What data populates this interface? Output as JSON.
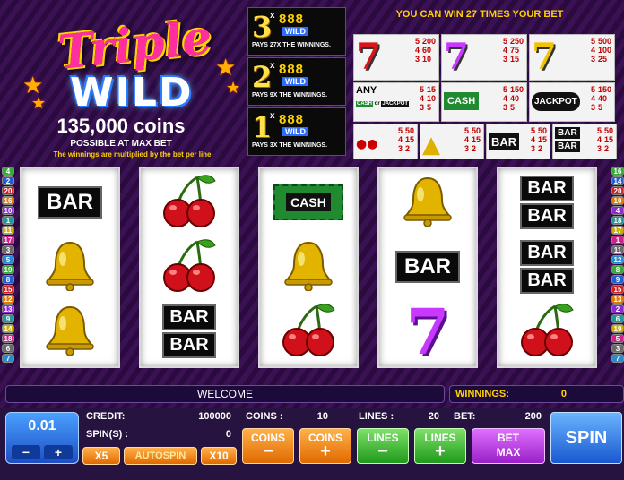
{
  "logo": {
    "word1": "Triple",
    "word2": "WILD",
    "coins": "135,000 coins",
    "possible": "POSSIBLE AT MAX BET",
    "note": "The winnings are multiplied by the bet per line"
  },
  "multipliers": [
    {
      "mult": "3",
      "x": "x",
      "symbol": "888",
      "wild": "WILD",
      "pays": "PAYS 27X THE WINNINGS."
    },
    {
      "mult": "2",
      "x": "x",
      "symbol": "888",
      "wild": "WILD",
      "pays": "PAYS 9X THE WINNINGS."
    },
    {
      "mult": "1",
      "x": "x",
      "symbol": "888",
      "wild": "WILD",
      "pays": "PAYS 3X THE WINNINGS."
    }
  ],
  "paytable": {
    "title": "YOU CAN WIN 27 TIMES YOUR BET",
    "row1": [
      {
        "symbol": "red-seven",
        "keys": [
          "5",
          "4",
          "3"
        ],
        "vals": [
          "200",
          "60",
          "10"
        ],
        "color": "#d8141c"
      },
      {
        "symbol": "purple-seven",
        "keys": [
          "5",
          "4",
          "3"
        ],
        "vals": [
          "250",
          "75",
          "15"
        ],
        "color": "#c838ff"
      },
      {
        "symbol": "gold-seven",
        "keys": [
          "5",
          "4",
          "3"
        ],
        "vals": [
          "500",
          "100",
          "25"
        ],
        "color": "#f2c400"
      }
    ],
    "row2": [
      {
        "label": "ANY",
        "symbol": "any-seven",
        "keys": [
          "5",
          "4",
          "3"
        ],
        "vals": [
          "15",
          "10",
          "5"
        ]
      },
      {
        "label": "CASH",
        "symbol": "cash",
        "keys": [
          "5",
          "4",
          "3"
        ],
        "vals": [
          "150",
          "40",
          "5"
        ]
      },
      {
        "label": "JACKPOT",
        "symbol": "jackpot",
        "keys": [
          "5",
          "4",
          "3"
        ],
        "vals": [
          "150",
          "40",
          "5"
        ]
      }
    ],
    "row2_any_sub": "CASH",
    "row2_any_sub2": "JACKPOT",
    "row2_any_or": "or",
    "row3": [
      {
        "symbol": "cherry",
        "keys": [
          "5",
          "4",
          "3"
        ],
        "vals": [
          "50",
          "15",
          "2"
        ]
      },
      {
        "symbol": "bell",
        "keys": [
          "5",
          "4",
          "3"
        ],
        "vals": [
          "50",
          "15",
          "2"
        ]
      },
      {
        "label": "BAR",
        "symbol": "single-bar",
        "keys": [
          "5",
          "4",
          "3"
        ],
        "vals": [
          "50",
          "15",
          "2"
        ]
      },
      {
        "label": "BAR",
        "symbol": "double-bar",
        "keys": [
          "5",
          "4",
          "3"
        ],
        "vals": [
          "50",
          "15",
          "2"
        ]
      }
    ]
  },
  "line_numbers_left": [
    "4",
    "2",
    "20",
    "16",
    "10",
    "1",
    "11",
    "17",
    "3",
    "5",
    "19",
    "8",
    "15",
    "12",
    "13",
    "9",
    "14",
    "18",
    "6",
    "7"
  ],
  "line_numbers_right": [
    "16",
    "14",
    "20",
    "10",
    "4",
    "18",
    "17",
    "1",
    "11",
    "12",
    "8",
    "9",
    "15",
    "13",
    "2",
    "6",
    "19",
    "5",
    "3",
    "7"
  ],
  "line_colors": [
    "#3aa83a",
    "#1f5fd0",
    "#d02020",
    "#e07a00",
    "#8a2ad0",
    "#1f9a9a",
    "#c8b000",
    "#d0208a",
    "#6a6a6a",
    "#2a8ad0"
  ],
  "reels": [
    [
      "BAR",
      "bell",
      "bell"
    ],
    [
      "cherry",
      "cherry",
      "BAR BAR"
    ],
    [
      "CASH",
      "bell",
      "cherry"
    ],
    [
      "bell",
      "BAR",
      "seven"
    ],
    [
      "BAR BAR",
      "BAR BAR",
      "cherry"
    ]
  ],
  "message": "WELCOME",
  "winnings": {
    "label": "WINNINGS:",
    "value": "0"
  },
  "stats": {
    "credit_label": "CREDIT:",
    "credit": "100000",
    "spins_label": "SPIN(S) :",
    "spins": "0",
    "coins_label": "COINS :",
    "coins": "10",
    "lines_label": "LINES :",
    "lines": "20",
    "bet_label": "BET:",
    "bet": "200"
  },
  "denomination": {
    "value": "0.01",
    "minus": "−",
    "plus": "+"
  },
  "buttons": {
    "x5": "X5",
    "autospin": "AUTOSPIN",
    "x10": "X10",
    "coins": "COINS",
    "lines": "LINES",
    "bet": "BET",
    "max": "MAX",
    "minus": "−",
    "plus": "+",
    "spin": "SPIN"
  }
}
